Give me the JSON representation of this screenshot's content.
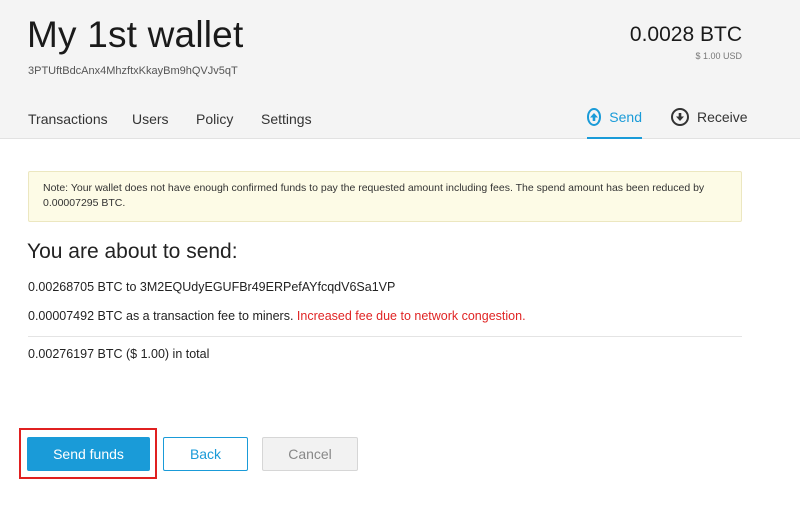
{
  "wallet": {
    "title": "My 1st wallet",
    "address": "3PTUftBdcAnx4MhzftxKkayBm9hQVJv5qT",
    "balance_btc": "0.0028 BTC",
    "balance_usd": "$ 1.00 USD"
  },
  "tabs": [
    {
      "label": "Transactions"
    },
    {
      "label": "Users"
    },
    {
      "label": "Policy"
    },
    {
      "label": "Settings"
    }
  ],
  "actions": {
    "send_label": "Send",
    "send_icon": "arrow-up-circle-icon",
    "receive_label": "Receive",
    "receive_icon": "arrow-down-circle-icon",
    "active": "Send"
  },
  "note": "Note: Your wallet does not have enough confirmed funds to pay the requested amount including fees. The spend amount has been reduced by 0.00007295 BTC.",
  "summary": {
    "heading": "You are about to send:",
    "recipient_line": "0.00268705 BTC to 3M2EQUdyEGUFBr49ERPefAYfcqdV6Sa1VP",
    "fee_line": "0.00007492 BTC as a transaction fee to miners.",
    "fee_warning": "Increased fee due to network congestion.",
    "total_line": "0.00276197 BTC ($ 1.00) in total"
  },
  "buttons": {
    "send_funds": "Send funds",
    "back": "Back",
    "cancel": "Cancel"
  },
  "colors": {
    "accent": "#1a9bd8",
    "warning": "#e02424",
    "highlight": "#e02020",
    "note_bg": "#fdfbe6"
  }
}
